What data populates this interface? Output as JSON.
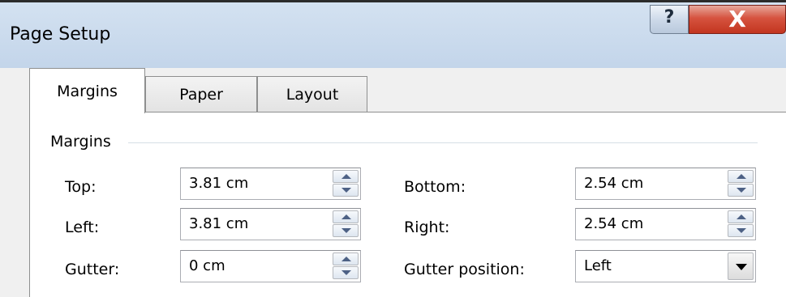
{
  "window": {
    "title": "Page Setup",
    "help_glyph": "?",
    "close_glyph": "X"
  },
  "tabs": [
    {
      "label": "Margins",
      "active": true
    },
    {
      "label": "Paper",
      "active": false
    },
    {
      "label": "Layout",
      "active": false
    }
  ],
  "margins_group": {
    "label": "Margins",
    "top": {
      "label": "Top:",
      "value": "3.81 cm"
    },
    "left": {
      "label": "Left:",
      "value": "3.81 cm"
    },
    "gutter": {
      "label": "Gutter:",
      "value": "0 cm"
    },
    "bottom": {
      "label": "Bottom:",
      "value": "2.54 cm"
    },
    "right": {
      "label": "Right:",
      "value": "2.54 cm"
    },
    "gutter_position": {
      "label": "Gutter position:",
      "value": "Left"
    }
  },
  "colors": {
    "titlebar": "#c3d5ea",
    "close_button": "#c2351f",
    "dialog_bg": "#f0f0f0",
    "arrow": "#4d6185"
  },
  "icons": {
    "help": "help-icon",
    "close": "close-icon",
    "spin_up": "chevron-up-icon",
    "spin_down": "chevron-down-icon",
    "dropdown": "dropdown-arrow-icon"
  }
}
